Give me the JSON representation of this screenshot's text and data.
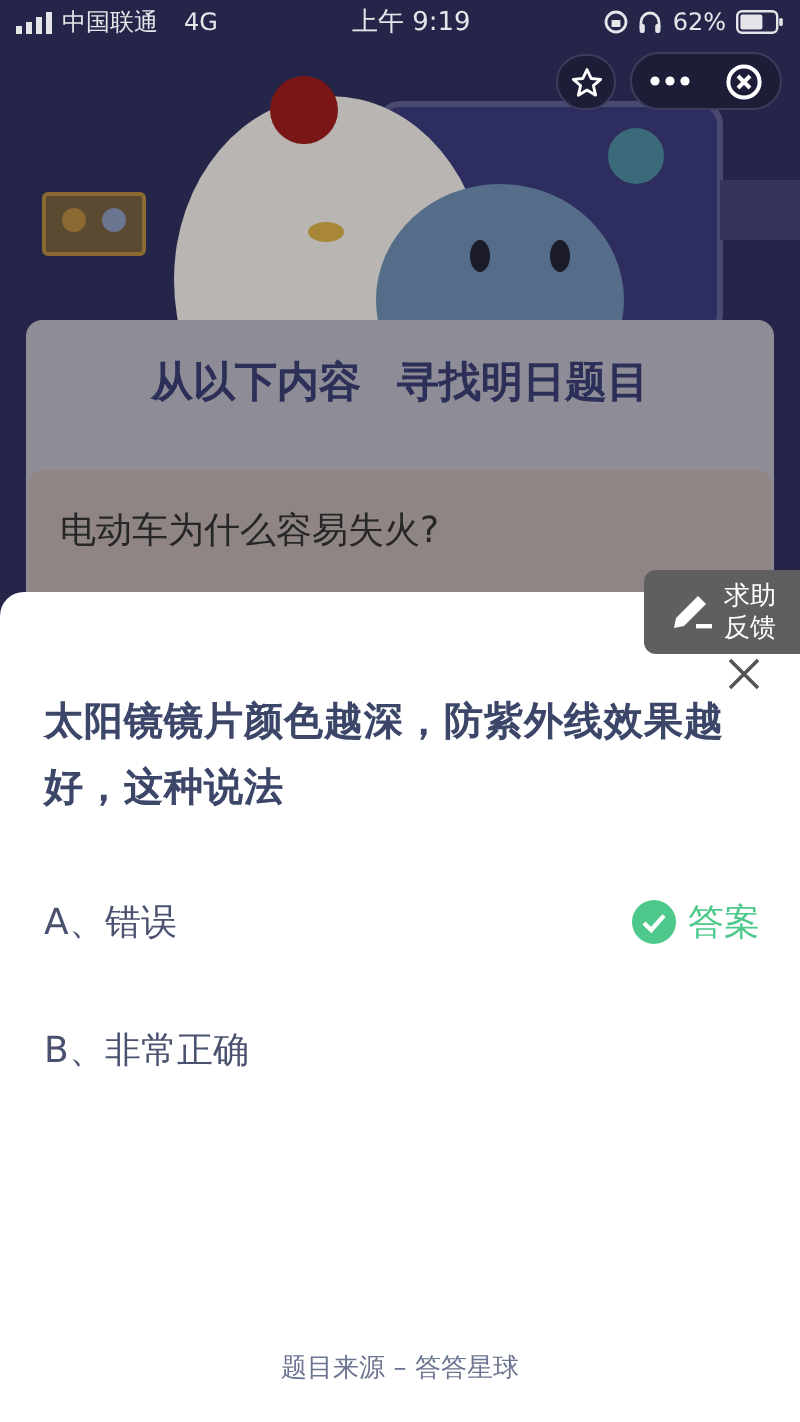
{
  "status_bar": {
    "carrier": "中国联通",
    "network": "4G",
    "time": "上午 9:19",
    "battery": "62%"
  },
  "background_page": {
    "banner_title": [
      "从以下内容",
      "寻找明日题目"
    ],
    "tip_title": "电动车为什么容易失火?"
  },
  "help_button": {
    "label": "求助反馈"
  },
  "sheet": {
    "question": "太阳镜镜片颜色越深，防紫外线效果越好，这种说法",
    "options": [
      {
        "label": "A、错误",
        "is_answer": true
      },
      {
        "label": "B、非常正确",
        "is_answer": false
      }
    ],
    "answer_label": "答案",
    "footer": "题目来源 – 答答星球"
  }
}
